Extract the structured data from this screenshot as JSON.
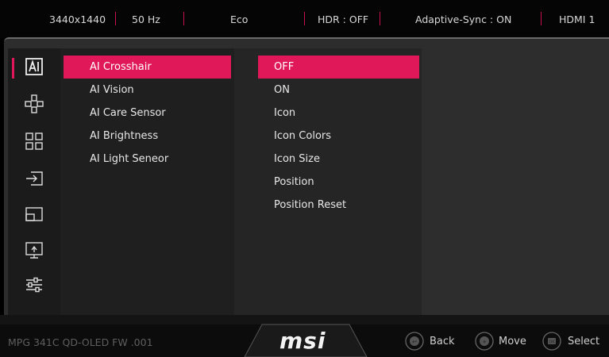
{
  "status_bar": {
    "resolution": "3440x1440",
    "refresh": "50 Hz",
    "mode": "Eco",
    "hdr": "HDR : OFF",
    "adaptive_sync": "Adaptive-Sync : ON",
    "input": "HDMI 1"
  },
  "sidebar": {
    "icons": [
      "ai-icon",
      "gamepad-icon",
      "apps-grid-icon",
      "input-source-icon",
      "pip-icon",
      "display-icon",
      "settings-sliders-icon"
    ],
    "active_index": 0
  },
  "menu": {
    "items": [
      "AI Crosshair",
      "AI Vision",
      "AI Care Sensor",
      "AI Brightness",
      "AI Light Seneor"
    ],
    "selected_index": 0
  },
  "options": {
    "items": [
      "OFF",
      "ON",
      "Icon",
      "Icon Colors",
      "Icon Size",
      "Position",
      "Position Reset"
    ],
    "selected_index": 0
  },
  "footer": {
    "model": "MPG 341C QD-OLED  FW .001",
    "brand": "msi",
    "back_label": "Back",
    "move_label": "Move",
    "select_label": "Select",
    "back_icon_label": "↩",
    "move_icon_label": "+",
    "select_icon_label": "OK"
  },
  "colors": {
    "accent": "#e0185a",
    "background": "#2d2d2d"
  }
}
